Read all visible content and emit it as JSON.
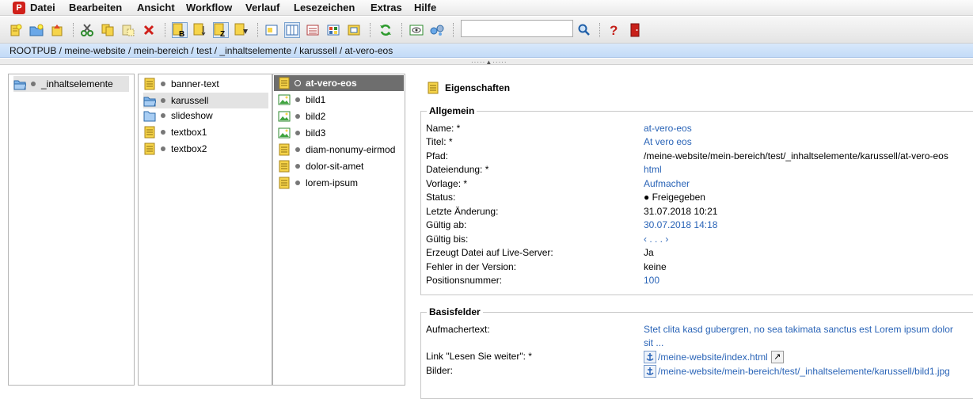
{
  "menu": [
    "Datei",
    "Bearbeiten",
    "Ansicht",
    "Workflow",
    "Verlauf",
    "Lesezeichen",
    "Extras",
    "Hilfe"
  ],
  "app_logo": "P",
  "search": {
    "value": "",
    "placeholder": ""
  },
  "breadcrumb": "ROOTPUB / meine-website / mein-bereich / test / _inhaltselemente / karussell / at-vero-eos",
  "column1": {
    "items": [
      {
        "label": "_inhaltselemente",
        "icon": "folder-open-icon"
      }
    ]
  },
  "column2": {
    "items": [
      {
        "label": "banner-text",
        "icon": "page-icon"
      },
      {
        "label": "karussell",
        "icon": "folder-open-icon"
      },
      {
        "label": "slideshow",
        "icon": "folder-icon"
      },
      {
        "label": "textbox1",
        "icon": "page-icon"
      },
      {
        "label": "textbox2",
        "icon": "page-icon"
      }
    ]
  },
  "column3": {
    "items": [
      {
        "label": "at-vero-eos",
        "icon": "page-icon"
      },
      {
        "label": "bild1",
        "icon": "image-icon"
      },
      {
        "label": "bild2",
        "icon": "image-icon"
      },
      {
        "label": "bild3",
        "icon": "image-icon"
      },
      {
        "label": "diam-nonumy-eirmod",
        "icon": "page-icon"
      },
      {
        "label": "dolor-sit-amet",
        "icon": "page-icon"
      },
      {
        "label": "lorem-ipsum",
        "icon": "page-icon"
      }
    ]
  },
  "properties": {
    "title": "Eigenschaften",
    "allgemein": {
      "legend": "Allgemein",
      "rows": [
        {
          "label": "Name: *",
          "value": "at-vero-eos",
          "link": true
        },
        {
          "label": "Titel: *",
          "value": "At vero eos",
          "link": true
        },
        {
          "label": "Pfad:",
          "value": "/meine-website/mein-bereich/test/_inhaltselemente/karussell/at-vero-eos",
          "link": false
        },
        {
          "label": "Dateiendung: *",
          "value": "html",
          "link": true
        },
        {
          "label": "Vorlage: *",
          "value": "Aufmacher",
          "link": true
        },
        {
          "label": "Status:",
          "value": "● Freigegeben",
          "link": false
        },
        {
          "label": "Letzte Änderung:",
          "value": "31.07.2018 10:21",
          "link": false
        },
        {
          "label": "Gültig ab:",
          "value": "30.07.2018 14:18",
          "link": true
        },
        {
          "label": "Gültig bis:",
          "value": "‹ . . . ›",
          "link": true
        },
        {
          "label": "Erzeugt Datei auf Live-Server:",
          "value": "Ja",
          "link": false
        },
        {
          "label": "Fehler in der Version:",
          "value": "keine",
          "link": false
        },
        {
          "label": "Positionsnummer:",
          "value": "100",
          "link": true
        }
      ]
    },
    "basisfelder": {
      "legend": "Basisfelder",
      "aufmacher_label": "Aufmachertext:",
      "aufmacher_value_1": "Stet clita kasd gubergren, no sea takimata sanctus est Lorem ipsum dolor",
      "aufmacher_value_2": "sit ...",
      "link_label": "Link \"Lesen Sie weiter\": *",
      "link_value": "/meine-website/index.html",
      "bilder_label": "Bilder:",
      "bilder_value": "/meine-website/mein-bereich/test/_inhaltselemente/karussell/bild1.jpg"
    }
  }
}
